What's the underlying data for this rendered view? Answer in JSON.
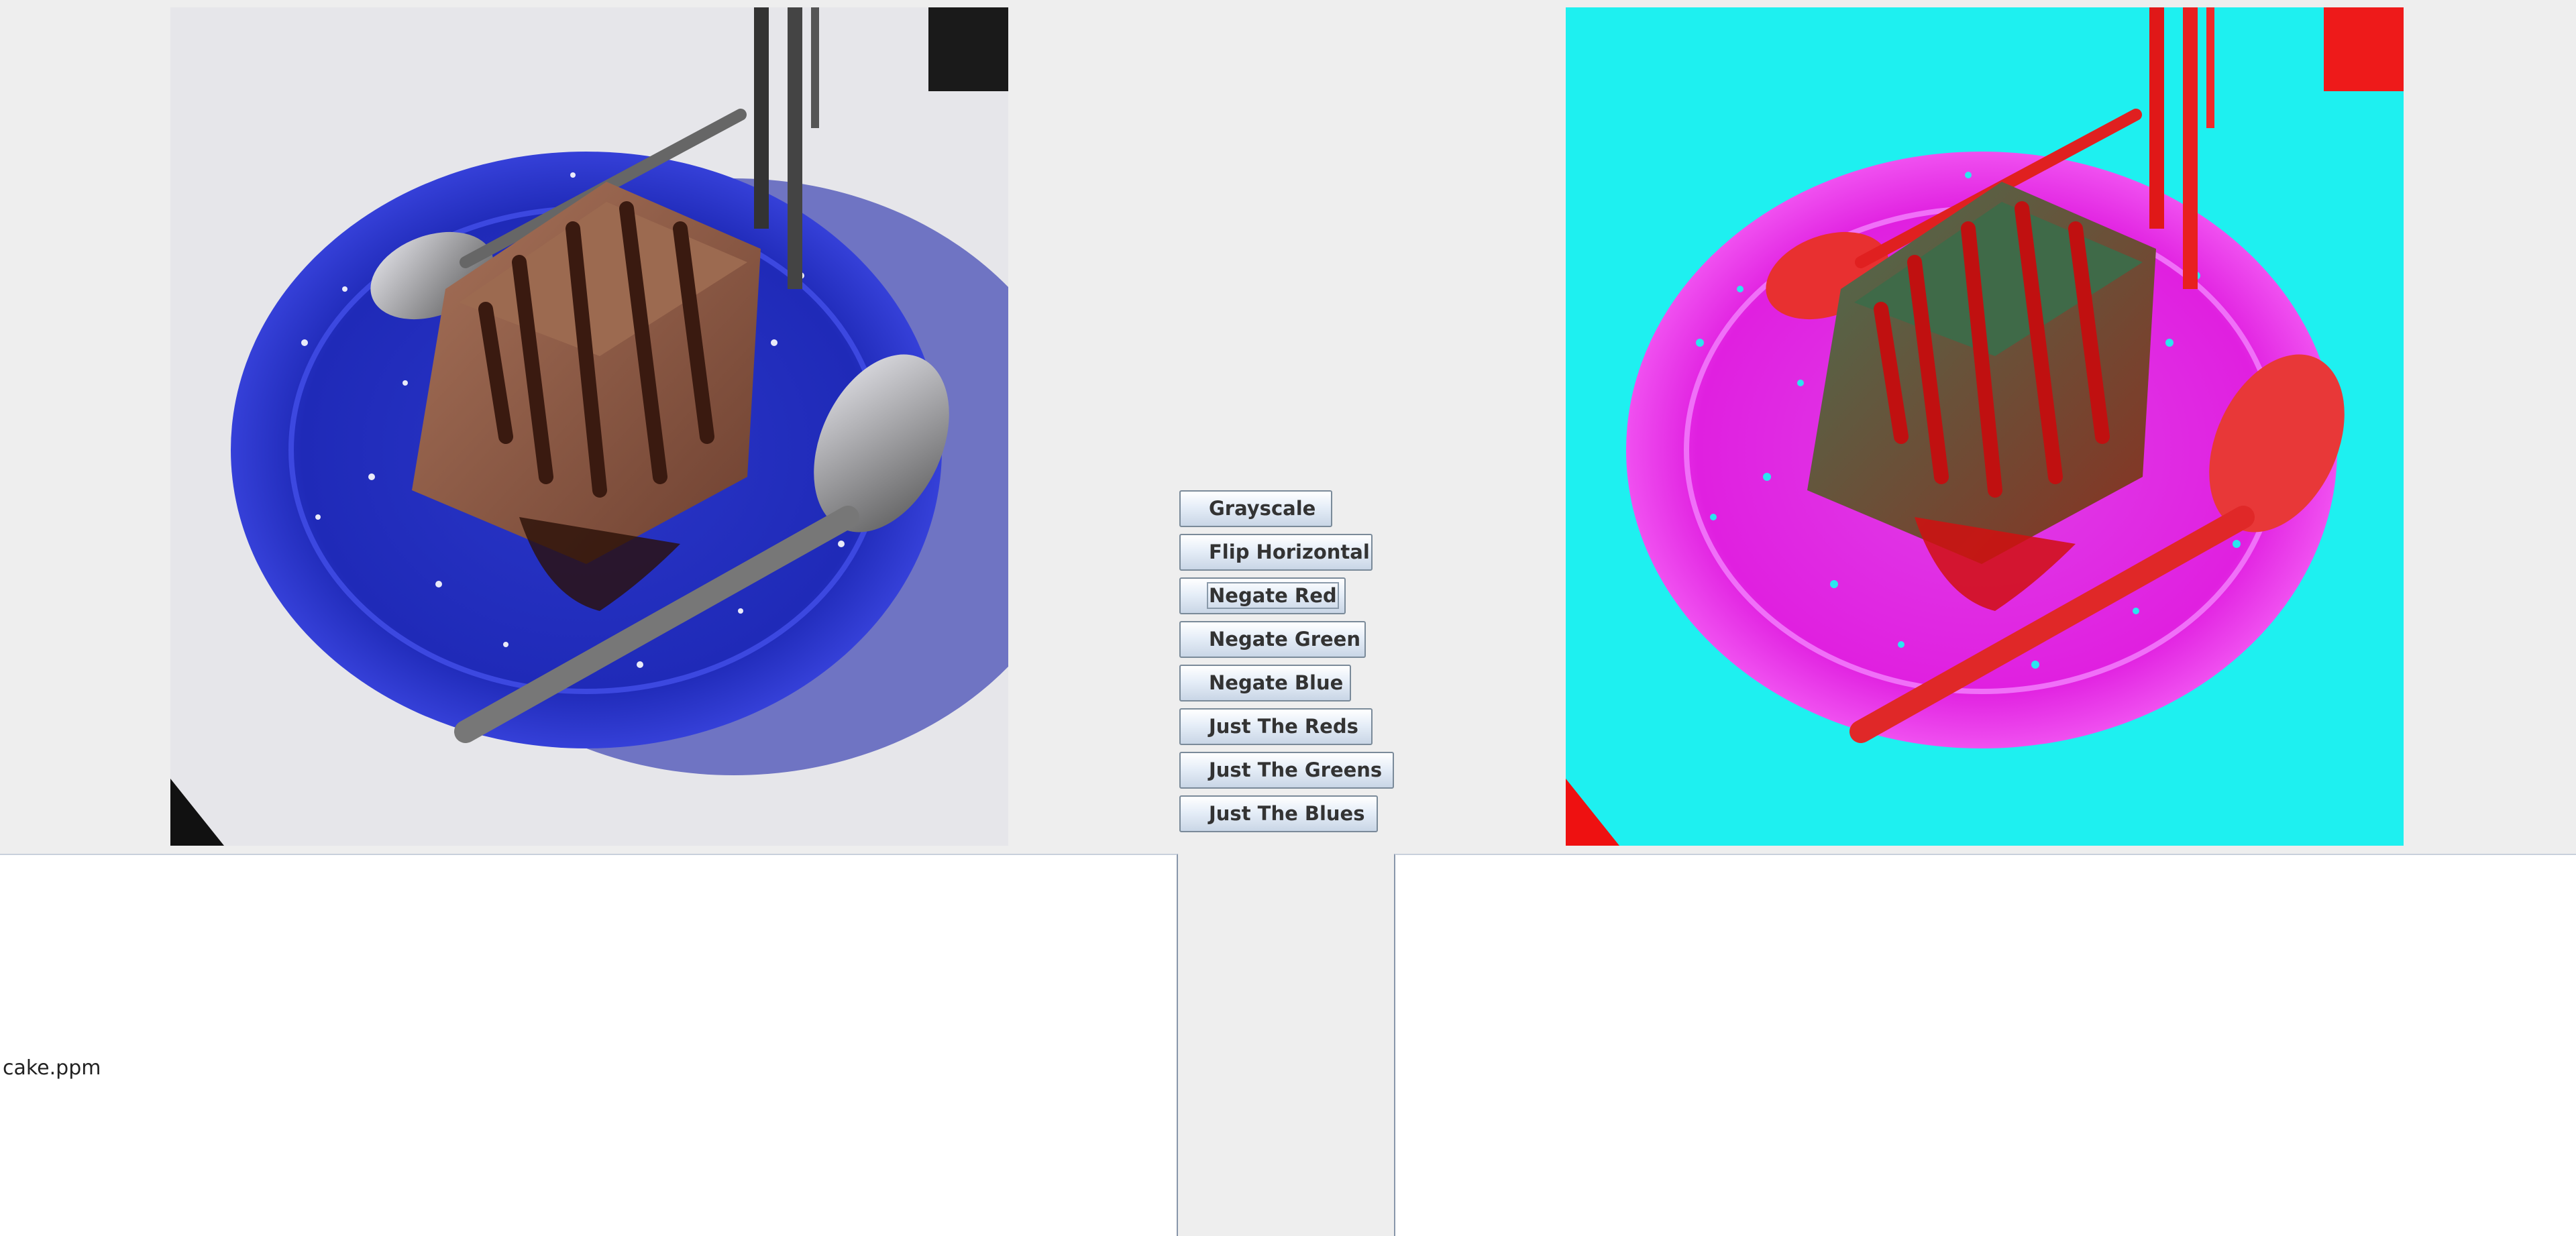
{
  "images": {
    "original": "cake-photo",
    "processed": "cake-photo-negated-red"
  },
  "buttons": [
    {
      "label": "Grayscale"
    },
    {
      "label": "Flip Horizontal"
    },
    {
      "label": "Negate Red"
    },
    {
      "label": "Negate Green"
    },
    {
      "label": "Negate Blue"
    },
    {
      "label": "Just The Reds"
    },
    {
      "label": "Just The Greens"
    },
    {
      "label": "Just The Blues"
    }
  ],
  "status": {
    "filename": "cake.ppm"
  }
}
